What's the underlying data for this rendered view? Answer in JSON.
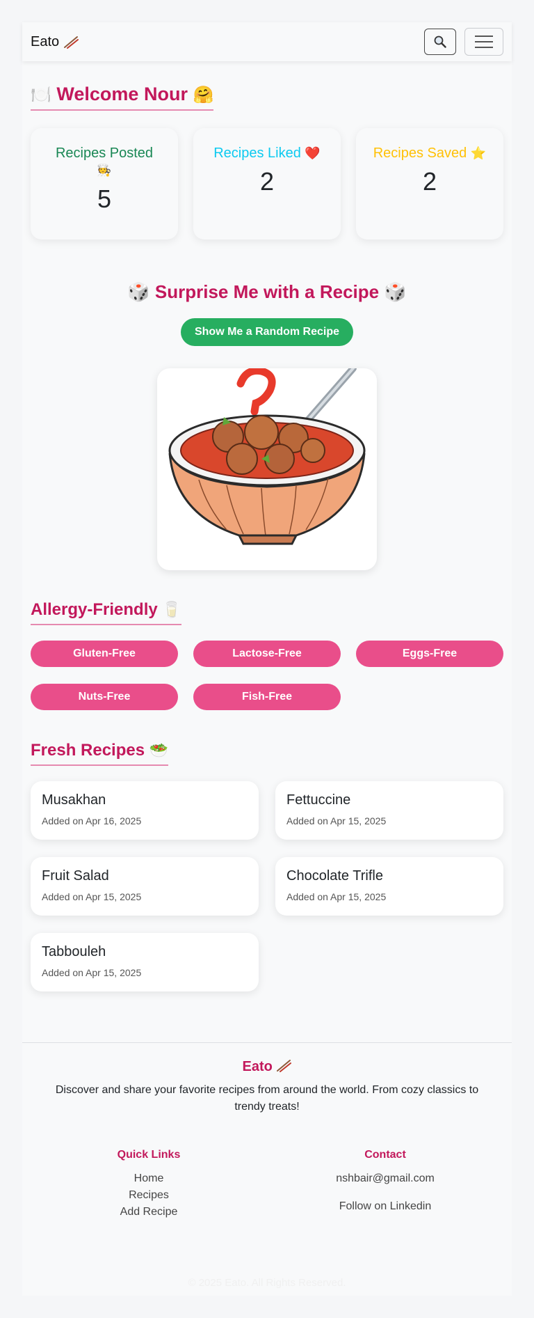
{
  "navbar": {
    "brand": "Eato",
    "brand_icon": "chopsticks-icon"
  },
  "welcome": {
    "title": "Welcome Nour",
    "lead_emoji": "🍽️",
    "trail_emoji": "🤗"
  },
  "stats": [
    {
      "label": "Recipes Posted",
      "emoji": "🧑‍🍳",
      "value": "5",
      "color": "#198754"
    },
    {
      "label": "Recipes Liked",
      "emoji": "❤️",
      "value": "2",
      "color": "#0dcaf0"
    },
    {
      "label": "Recipes Saved",
      "emoji": "⭐",
      "value": "2",
      "color": "#ffc107"
    }
  ],
  "surprise": {
    "title": "🎲 Surprise Me with a Recipe 🎲",
    "button": "Show Me a Random Recipe"
  },
  "allergy": {
    "title": "Allergy-Friendly",
    "emoji": "🥛",
    "tags": [
      "Gluten-Free",
      "Lactose-Free",
      "Eggs-Free",
      "Nuts-Free",
      "Fish-Free"
    ]
  },
  "fresh": {
    "title": "Fresh Recipes",
    "emoji": "🥗",
    "recipes": [
      {
        "name": "Musakhan",
        "date": "Added on Apr 16, 2025"
      },
      {
        "name": "Fettuccine",
        "date": "Added on Apr 15, 2025"
      },
      {
        "name": "Fruit Salad",
        "date": "Added on Apr 15, 2025"
      },
      {
        "name": "Chocolate Trifle",
        "date": "Added on Apr 15, 2025"
      },
      {
        "name": "Tabbouleh",
        "date": "Added on Apr 15, 2025"
      }
    ]
  },
  "footer": {
    "brand": "Eato",
    "description": "Discover and share your favorite recipes from around the world. From cozy classics to trendy treats!",
    "quick_links": {
      "title": "Quick Links",
      "items": [
        "Home",
        "Recipes",
        "Add Recipe"
      ]
    },
    "contact": {
      "title": "Contact",
      "email": "nshbair@gmail.com",
      "linkedin": "Follow on Linkedin"
    },
    "copyright": "© 2025 Eato. All Rights Reserved."
  },
  "colors": {
    "accent": "#c2185b",
    "pill": "#e94e8a",
    "button": "#27ae60"
  }
}
